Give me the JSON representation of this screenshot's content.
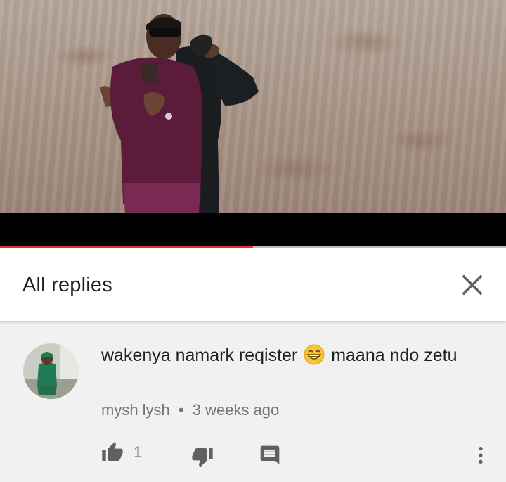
{
  "video": {
    "progress_fraction": 0.5,
    "progress_color": "#e52d27"
  },
  "header": {
    "title": "All replies",
    "close_icon": "close-icon"
  },
  "comment": {
    "text_part1": "wakenya namark reqister",
    "emoji": "grinning-face-emoji",
    "text_part2": "maana ndo zetu",
    "author": "mysh lysh",
    "separator": "•",
    "time": "3 weeks ago",
    "like_count": "1",
    "icons": [
      "thumb-up-icon",
      "thumb-down-icon",
      "reply-icon",
      "more-vert-icon"
    ]
  }
}
